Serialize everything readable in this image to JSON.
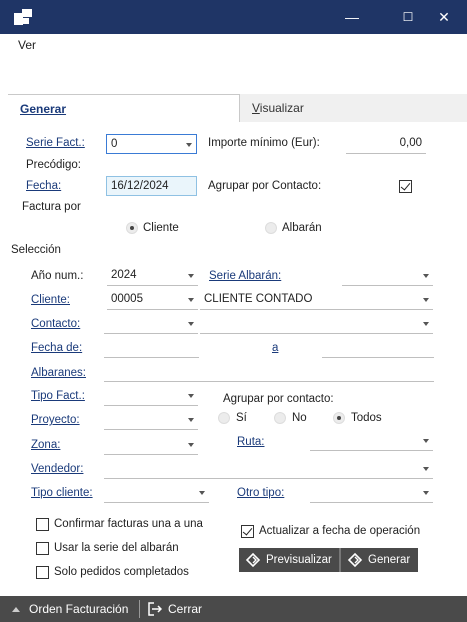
{
  "window": {
    "minimize": "—",
    "maximize": "☐",
    "close": "✕"
  },
  "menu": {
    "ver": "Ver"
  },
  "tabs": {
    "generar": "Generar",
    "visualizar_first": "V",
    "visualizar_rest": "isualizar"
  },
  "form": {
    "serie_fact": {
      "label": "Serie Fact.:",
      "value": "0"
    },
    "importe_minimo": {
      "label": "Importe mínimo (Eur):",
      "value": "0,00"
    },
    "precodigo": {
      "label": "Precódigo:"
    },
    "fecha": {
      "label": "Fecha:",
      "value": "16/12/2024"
    },
    "agrupar_por_contacto": {
      "label": "Agrupar por Contacto:",
      "checked": true
    },
    "factura_por": {
      "label": "Factura por",
      "options": [
        "Cliente",
        "Albarán"
      ],
      "selected": "Cliente"
    }
  },
  "seleccion": {
    "title": "Selección",
    "anio": {
      "label": "Año num.:",
      "value": "2024"
    },
    "serie_albaran": {
      "label": "Serie Albarán:",
      "value": ""
    },
    "cliente": {
      "label": "Cliente:",
      "code": "00005",
      "name": "CLIENTE CONTADO"
    },
    "contacto": {
      "label": "Contacto:"
    },
    "fecha_de": {
      "label": "Fecha de:",
      "a_label": "a"
    },
    "albaranes": {
      "label": "Albaranes:"
    },
    "tipo_fact": {
      "label": "Tipo Fact.:"
    },
    "agrupar_contacto": {
      "label": "Agrupar por contacto:",
      "options": [
        "Sí",
        "No",
        "Todos"
      ],
      "selected": "Todos"
    },
    "proyecto": {
      "label": "Proyecto:"
    },
    "zona": {
      "label": "Zona:"
    },
    "ruta": {
      "label": "Ruta:"
    },
    "vendedor": {
      "label": "Vendedor:"
    },
    "tipo_cliente": {
      "label": "Tipo cliente:"
    },
    "otro_tipo": {
      "label": "Otro tipo:"
    }
  },
  "options": {
    "confirmar": {
      "label": "Confirmar facturas una a una",
      "checked": false
    },
    "usar_serie": {
      "label": "Usar la serie del albarán",
      "checked": false
    },
    "solo_pedidos": {
      "label": "Solo pedidos completados",
      "checked": false
    },
    "actualizar_fecha": {
      "label": "Actualizar a fecha de operación",
      "checked": true
    }
  },
  "buttons": {
    "previsualizar": "Previsualizar",
    "generar": "Generar"
  },
  "statusbar": {
    "orden": "Orden Facturación",
    "cerrar": "Cerrar"
  }
}
